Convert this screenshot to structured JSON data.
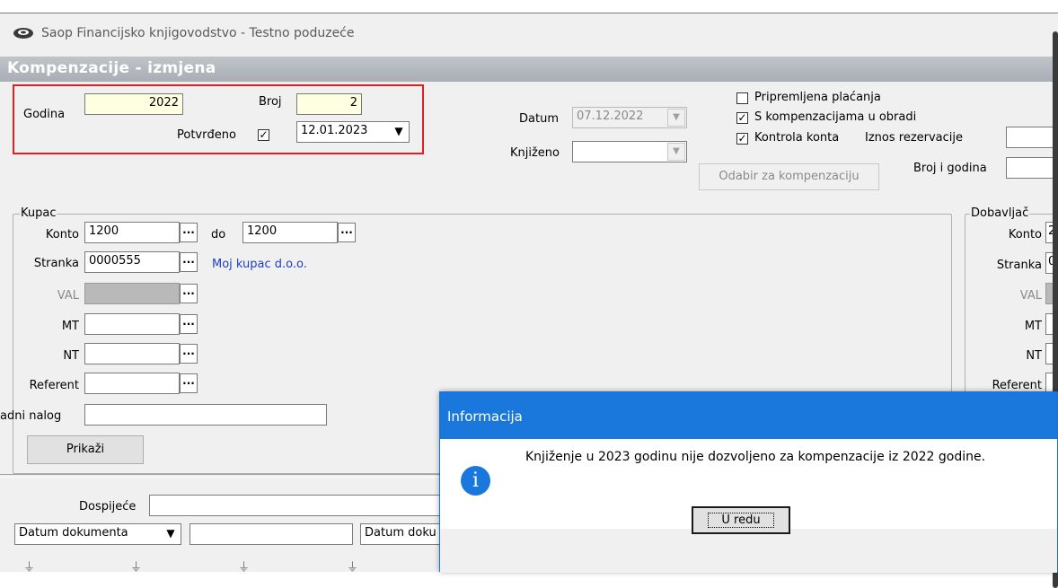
{
  "window": {
    "title": "Saop Financijsko knjigovodstvo - Testno poduzeće"
  },
  "header": {
    "title": "Kompenzacije -  izmjena"
  },
  "top": {
    "godina_label": "Godina",
    "godina_value": "2022",
    "broj_label": "Broj",
    "broj_value": "2",
    "potvrdeno_label": "Potvrđeno",
    "potvrdeno_checked": "✓",
    "potvrdeno_date": "12.01.2023",
    "datum_label": "Datum",
    "datum_value": "07.12.2022",
    "knjizeno_label": "Knjiženo",
    "knjizeno_value": "",
    "cb_pripremljena": "Pripremljena plaćanja",
    "cb_pripremljena_mark": "",
    "cb_s_komp": "S kompenzacijama u obradi",
    "cb_s_komp_mark": "✓",
    "cb_kontrola": "Kontrola konta",
    "cb_kontrola_mark": "✓",
    "iznos_label": "Iznos rezervacije",
    "broj_godina_label": "Broj i godina",
    "odabir_button": "Odabir za kompenzaciju"
  },
  "kupac": {
    "group_label": "Kupac",
    "konto_label": "Konto",
    "konto_from": "1200",
    "do_label": "do",
    "konto_to": "1200",
    "stranka_label": "Stranka",
    "stranka_value": "0000555",
    "stranka_name": "Moj kupac d.o.o.",
    "val_label": "VAL",
    "mt_label": "MT",
    "nt_label": "NT",
    "referent_label": "Referent",
    "nalog_label": "adni nalog",
    "dots": "...",
    "prikazi_button": "Prikaži"
  },
  "dobavljac": {
    "group_label": "Dobavljač",
    "konto_label": "Konto",
    "konto_value": "2",
    "stranka_label": "Stranka",
    "stranka_value": "0",
    "val_label": "VAL",
    "mt_label": "MT",
    "nt_label": "NT",
    "referent_label": "Referent"
  },
  "bottom": {
    "dospijece_label": "Dospijeće",
    "sort_select": "Datum dokumenta",
    "sort_select_2": "Datum doku"
  },
  "dialog": {
    "title": "Informacija",
    "icon": "i",
    "message": "Knjiženje u 2023 godinu nije dozvoljeno za kompenzacije iz 2022 godine.",
    "ok_button": "U redu"
  },
  "colors": {
    "dialog_title": "#1a78dc",
    "highlight_box": "#e02020",
    "link_text": "#1f3fc4"
  }
}
